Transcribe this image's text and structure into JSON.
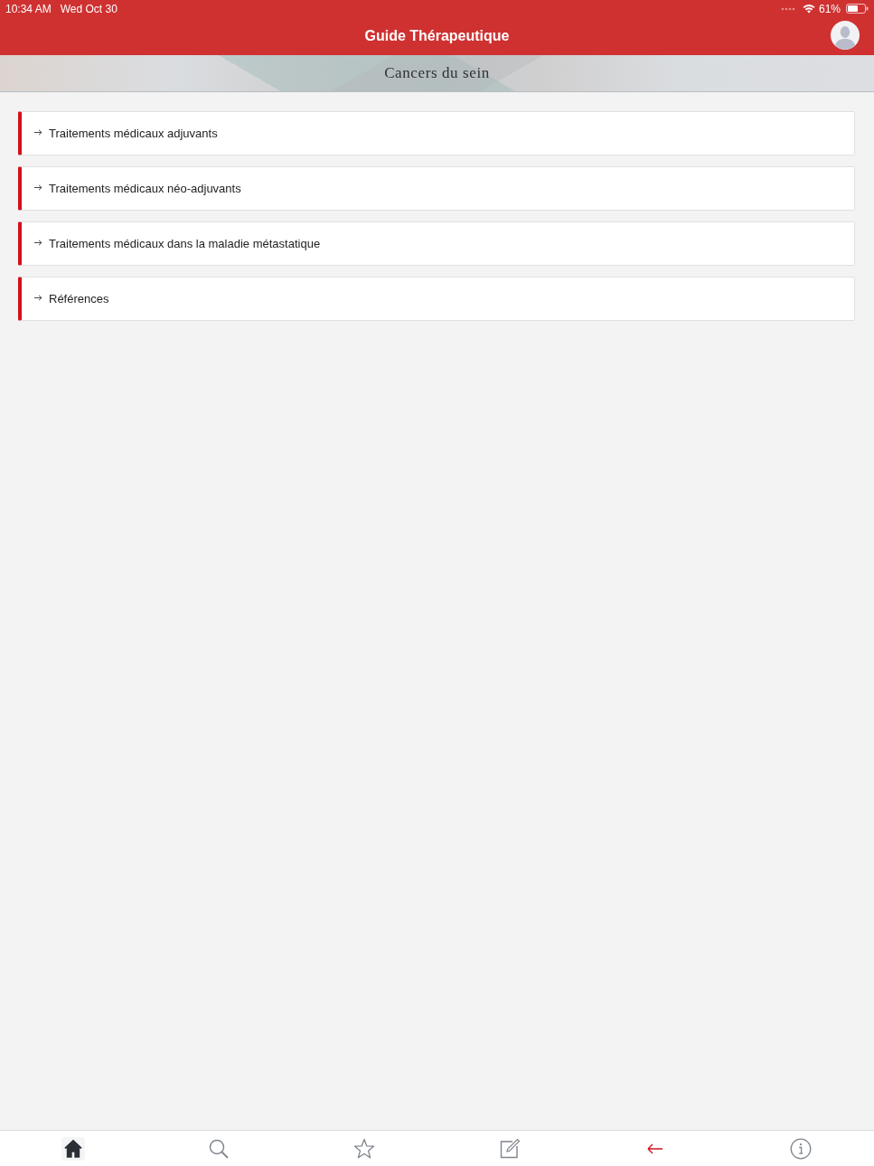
{
  "status_bar": {
    "time": "10:34 AM",
    "date": "Wed Oct 30",
    "battery": "61%"
  },
  "header": {
    "title": "Guide Thérapeutique"
  },
  "banner": {
    "title": "Cancers du sein"
  },
  "menu": [
    {
      "label": "Traitements médicaux adjuvants"
    },
    {
      "label": "Traitements médicaux néo-adjuvants"
    },
    {
      "label": "Traitements médicaux dans la maladie métastatique"
    },
    {
      "label": "Références"
    }
  ],
  "tab_bar": [
    {
      "kind": "home",
      "selected": true
    },
    {
      "kind": "search",
      "selected": false
    },
    {
      "kind": "favorites",
      "selected": false
    },
    {
      "kind": "notes",
      "selected": false
    },
    {
      "kind": "back",
      "selected": false
    },
    {
      "kind": "info",
      "selected": false
    }
  ]
}
